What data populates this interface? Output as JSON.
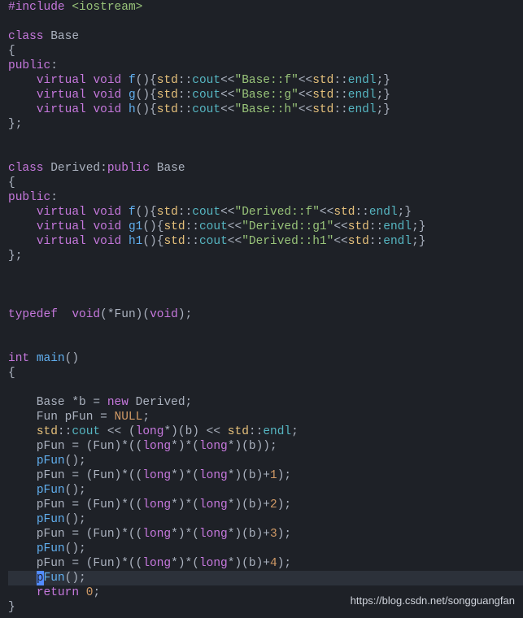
{
  "code": {
    "lines": [
      {
        "segments": [
          {
            "t": "#include",
            "c": "preprocessor"
          },
          {
            "t": " ",
            "c": "text-white"
          },
          {
            "t": "<iostream>",
            "c": "header-green"
          }
        ]
      },
      {
        "segments": []
      },
      {
        "segments": [
          {
            "t": "class",
            "c": "keyword-purple"
          },
          {
            "t": " Base",
            "c": "text-white"
          }
        ]
      },
      {
        "segments": [
          {
            "t": "{",
            "c": "text-white"
          }
        ]
      },
      {
        "segments": [
          {
            "t": "public",
            "c": "keyword-purple"
          },
          {
            "t": ":",
            "c": "text-white"
          }
        ]
      },
      {
        "segments": [
          {
            "t": "    ",
            "c": "text-white"
          },
          {
            "t": "virtual",
            "c": "keyword-purple"
          },
          {
            "t": " ",
            "c": "text-white"
          },
          {
            "t": "void",
            "c": "keyword-purple"
          },
          {
            "t": " ",
            "c": "text-white"
          },
          {
            "t": "f",
            "c": "func-blue"
          },
          {
            "t": "(){",
            "c": "text-white"
          },
          {
            "t": "std",
            "c": "std-yellow"
          },
          {
            "t": "::",
            "c": "text-white"
          },
          {
            "t": "cout",
            "c": "cout-teal"
          },
          {
            "t": "<<",
            "c": "text-white"
          },
          {
            "t": "\"Base::f\"",
            "c": "string-green"
          },
          {
            "t": "<<",
            "c": "text-white"
          },
          {
            "t": "std",
            "c": "std-yellow"
          },
          {
            "t": "::",
            "c": "text-white"
          },
          {
            "t": "endl",
            "c": "cout-teal"
          },
          {
            "t": ";}",
            "c": "text-white"
          }
        ]
      },
      {
        "segments": [
          {
            "t": "    ",
            "c": "text-white"
          },
          {
            "t": "virtual",
            "c": "keyword-purple"
          },
          {
            "t": " ",
            "c": "text-white"
          },
          {
            "t": "void",
            "c": "keyword-purple"
          },
          {
            "t": " ",
            "c": "text-white"
          },
          {
            "t": "g",
            "c": "func-blue"
          },
          {
            "t": "(){",
            "c": "text-white"
          },
          {
            "t": "std",
            "c": "std-yellow"
          },
          {
            "t": "::",
            "c": "text-white"
          },
          {
            "t": "cout",
            "c": "cout-teal"
          },
          {
            "t": "<<",
            "c": "text-white"
          },
          {
            "t": "\"Base::g\"",
            "c": "string-green"
          },
          {
            "t": "<<",
            "c": "text-white"
          },
          {
            "t": "std",
            "c": "std-yellow"
          },
          {
            "t": "::",
            "c": "text-white"
          },
          {
            "t": "endl",
            "c": "cout-teal"
          },
          {
            "t": ";}",
            "c": "text-white"
          }
        ]
      },
      {
        "segments": [
          {
            "t": "    ",
            "c": "text-white"
          },
          {
            "t": "virtual",
            "c": "keyword-purple"
          },
          {
            "t": " ",
            "c": "text-white"
          },
          {
            "t": "void",
            "c": "keyword-purple"
          },
          {
            "t": " ",
            "c": "text-white"
          },
          {
            "t": "h",
            "c": "func-blue"
          },
          {
            "t": "(){",
            "c": "text-white"
          },
          {
            "t": "std",
            "c": "std-yellow"
          },
          {
            "t": "::",
            "c": "text-white"
          },
          {
            "t": "cout",
            "c": "cout-teal"
          },
          {
            "t": "<<",
            "c": "text-white"
          },
          {
            "t": "\"Base::h\"",
            "c": "string-green"
          },
          {
            "t": "<<",
            "c": "text-white"
          },
          {
            "t": "std",
            "c": "std-yellow"
          },
          {
            "t": "::",
            "c": "text-white"
          },
          {
            "t": "endl",
            "c": "cout-teal"
          },
          {
            "t": ";}",
            "c": "text-white"
          }
        ]
      },
      {
        "segments": [
          {
            "t": "};",
            "c": "text-white"
          }
        ]
      },
      {
        "segments": []
      },
      {
        "segments": []
      },
      {
        "segments": [
          {
            "t": "class",
            "c": "keyword-purple"
          },
          {
            "t": " Derived:",
            "c": "text-white"
          },
          {
            "t": "public",
            "c": "keyword-purple"
          },
          {
            "t": " Base",
            "c": "text-white"
          }
        ]
      },
      {
        "segments": [
          {
            "t": "{",
            "c": "text-white"
          }
        ]
      },
      {
        "segments": [
          {
            "t": "public",
            "c": "keyword-purple"
          },
          {
            "t": ":",
            "c": "text-white"
          }
        ]
      },
      {
        "segments": [
          {
            "t": "    ",
            "c": "text-white"
          },
          {
            "t": "virtual",
            "c": "keyword-purple"
          },
          {
            "t": " ",
            "c": "text-white"
          },
          {
            "t": "void",
            "c": "keyword-purple"
          },
          {
            "t": " ",
            "c": "text-white"
          },
          {
            "t": "f",
            "c": "func-blue"
          },
          {
            "t": "(){",
            "c": "text-white"
          },
          {
            "t": "std",
            "c": "std-yellow"
          },
          {
            "t": "::",
            "c": "text-white"
          },
          {
            "t": "cout",
            "c": "cout-teal"
          },
          {
            "t": "<<",
            "c": "text-white"
          },
          {
            "t": "\"Derived::f\"",
            "c": "string-green"
          },
          {
            "t": "<<",
            "c": "text-white"
          },
          {
            "t": "std",
            "c": "std-yellow"
          },
          {
            "t": "::",
            "c": "text-white"
          },
          {
            "t": "endl",
            "c": "cout-teal"
          },
          {
            "t": ";}",
            "c": "text-white"
          }
        ]
      },
      {
        "segments": [
          {
            "t": "    ",
            "c": "text-white"
          },
          {
            "t": "virtual",
            "c": "keyword-purple"
          },
          {
            "t": " ",
            "c": "text-white"
          },
          {
            "t": "void",
            "c": "keyword-purple"
          },
          {
            "t": " ",
            "c": "text-white"
          },
          {
            "t": "g1",
            "c": "func-blue"
          },
          {
            "t": "(){",
            "c": "text-white"
          },
          {
            "t": "std",
            "c": "std-yellow"
          },
          {
            "t": "::",
            "c": "text-white"
          },
          {
            "t": "cout",
            "c": "cout-teal"
          },
          {
            "t": "<<",
            "c": "text-white"
          },
          {
            "t": "\"Derived::g1\"",
            "c": "string-green"
          },
          {
            "t": "<<",
            "c": "text-white"
          },
          {
            "t": "std",
            "c": "std-yellow"
          },
          {
            "t": "::",
            "c": "text-white"
          },
          {
            "t": "endl",
            "c": "cout-teal"
          },
          {
            "t": ";}",
            "c": "text-white"
          }
        ]
      },
      {
        "segments": [
          {
            "t": "    ",
            "c": "text-white"
          },
          {
            "t": "virtual",
            "c": "keyword-purple"
          },
          {
            "t": " ",
            "c": "text-white"
          },
          {
            "t": "void",
            "c": "keyword-purple"
          },
          {
            "t": " ",
            "c": "text-white"
          },
          {
            "t": "h1",
            "c": "func-blue"
          },
          {
            "t": "(){",
            "c": "text-white"
          },
          {
            "t": "std",
            "c": "std-yellow"
          },
          {
            "t": "::",
            "c": "text-white"
          },
          {
            "t": "cout",
            "c": "cout-teal"
          },
          {
            "t": "<<",
            "c": "text-white"
          },
          {
            "t": "\"Derived::h1\"",
            "c": "string-green"
          },
          {
            "t": "<<",
            "c": "text-white"
          },
          {
            "t": "std",
            "c": "std-yellow"
          },
          {
            "t": "::",
            "c": "text-white"
          },
          {
            "t": "endl",
            "c": "cout-teal"
          },
          {
            "t": ";}",
            "c": "text-white"
          }
        ]
      },
      {
        "segments": [
          {
            "t": "};",
            "c": "text-white"
          }
        ]
      },
      {
        "segments": []
      },
      {
        "segments": []
      },
      {
        "segments": []
      },
      {
        "segments": [
          {
            "t": "typedef",
            "c": "keyword-purple"
          },
          {
            "t": "  ",
            "c": "text-white"
          },
          {
            "t": "void",
            "c": "keyword-purple"
          },
          {
            "t": "(*Fun)(",
            "c": "text-white"
          },
          {
            "t": "void",
            "c": "keyword-purple"
          },
          {
            "t": ");",
            "c": "text-white"
          }
        ]
      },
      {
        "segments": []
      },
      {
        "segments": []
      },
      {
        "segments": [
          {
            "t": "int",
            "c": "keyword-purple"
          },
          {
            "t": " ",
            "c": "text-white"
          },
          {
            "t": "main",
            "c": "func-blue"
          },
          {
            "t": "()",
            "c": "text-white"
          }
        ]
      },
      {
        "segments": [
          {
            "t": "{",
            "c": "text-white"
          }
        ]
      },
      {
        "segments": []
      },
      {
        "segments": [
          {
            "t": "    Base *b = ",
            "c": "text-white"
          },
          {
            "t": "new",
            "c": "keyword-purple"
          },
          {
            "t": " Derived;",
            "c": "text-white"
          }
        ]
      },
      {
        "segments": [
          {
            "t": "    Fun pFun = ",
            "c": "text-white"
          },
          {
            "t": "NULL",
            "c": "null-orange"
          },
          {
            "t": ";",
            "c": "text-white"
          }
        ]
      },
      {
        "segments": [
          {
            "t": "    ",
            "c": "text-white"
          },
          {
            "t": "std",
            "c": "std-yellow"
          },
          {
            "t": "::",
            "c": "text-white"
          },
          {
            "t": "cout",
            "c": "cout-teal"
          },
          {
            "t": " << (",
            "c": "text-white"
          },
          {
            "t": "long",
            "c": "keyword-purple"
          },
          {
            "t": "*)(b) << ",
            "c": "text-white"
          },
          {
            "t": "std",
            "c": "std-yellow"
          },
          {
            "t": "::",
            "c": "text-white"
          },
          {
            "t": "endl",
            "c": "cout-teal"
          },
          {
            "t": ";",
            "c": "text-white"
          }
        ]
      },
      {
        "segments": [
          {
            "t": "    pFun = (Fun)*((",
            "c": "text-white"
          },
          {
            "t": "long",
            "c": "keyword-purple"
          },
          {
            "t": "*)*(",
            "c": "text-white"
          },
          {
            "t": "long",
            "c": "keyword-purple"
          },
          {
            "t": "*)(b));",
            "c": "text-white"
          }
        ]
      },
      {
        "segments": [
          {
            "t": "    ",
            "c": "text-white"
          },
          {
            "t": "pFun",
            "c": "func-blue"
          },
          {
            "t": "();",
            "c": "text-white"
          }
        ]
      },
      {
        "segments": [
          {
            "t": "    pFun = (Fun)*((",
            "c": "text-white"
          },
          {
            "t": "long",
            "c": "keyword-purple"
          },
          {
            "t": "*)*(",
            "c": "text-white"
          },
          {
            "t": "long",
            "c": "keyword-purple"
          },
          {
            "t": "*)(b)+",
            "c": "text-white"
          },
          {
            "t": "1",
            "c": "number-orange"
          },
          {
            "t": ");",
            "c": "text-white"
          }
        ]
      },
      {
        "segments": [
          {
            "t": "    ",
            "c": "text-white"
          },
          {
            "t": "pFun",
            "c": "func-blue"
          },
          {
            "t": "();",
            "c": "text-white"
          }
        ]
      },
      {
        "segments": [
          {
            "t": "    pFun = (Fun)*((",
            "c": "text-white"
          },
          {
            "t": "long",
            "c": "keyword-purple"
          },
          {
            "t": "*)*(",
            "c": "text-white"
          },
          {
            "t": "long",
            "c": "keyword-purple"
          },
          {
            "t": "*)(b)+",
            "c": "text-white"
          },
          {
            "t": "2",
            "c": "number-orange"
          },
          {
            "t": ");",
            "c": "text-white"
          }
        ]
      },
      {
        "segments": [
          {
            "t": "    ",
            "c": "text-white"
          },
          {
            "t": "pFun",
            "c": "func-blue"
          },
          {
            "t": "();",
            "c": "text-white"
          }
        ]
      },
      {
        "segments": [
          {
            "t": "    pFun = (Fun)*((",
            "c": "text-white"
          },
          {
            "t": "long",
            "c": "keyword-purple"
          },
          {
            "t": "*)*(",
            "c": "text-white"
          },
          {
            "t": "long",
            "c": "keyword-purple"
          },
          {
            "t": "*)(b)+",
            "c": "text-white"
          },
          {
            "t": "3",
            "c": "number-orange"
          },
          {
            "t": ");",
            "c": "text-white"
          }
        ]
      },
      {
        "segments": [
          {
            "t": "    ",
            "c": "text-white"
          },
          {
            "t": "pFun",
            "c": "func-blue"
          },
          {
            "t": "();",
            "c": "text-white"
          }
        ]
      },
      {
        "segments": [
          {
            "t": "    pFun = (Fun)*((",
            "c": "text-white"
          },
          {
            "t": "long",
            "c": "keyword-purple"
          },
          {
            "t": "*)*(",
            "c": "text-white"
          },
          {
            "t": "long",
            "c": "keyword-purple"
          },
          {
            "t": "*)(b)+",
            "c": "text-white"
          },
          {
            "t": "4",
            "c": "number-orange"
          },
          {
            "t": ");",
            "c": "text-white"
          }
        ]
      },
      {
        "highlighted": true,
        "cursor": true,
        "segments": [
          {
            "t": "    ",
            "c": "text-white"
          },
          {
            "t": "p",
            "c": "func-blue",
            "cursor": true
          },
          {
            "t": "Fun",
            "c": "func-blue"
          },
          {
            "t": "();",
            "c": "text-white"
          }
        ]
      },
      {
        "segments": [
          {
            "t": "    ",
            "c": "text-white"
          },
          {
            "t": "return",
            "c": "keyword-purple"
          },
          {
            "t": " ",
            "c": "text-white"
          },
          {
            "t": "0",
            "c": "number-orange"
          },
          {
            "t": ";",
            "c": "text-white"
          }
        ]
      },
      {
        "segments": [
          {
            "t": "}",
            "c": "text-white"
          }
        ]
      }
    ]
  },
  "watermark": "https://blog.csdn.net/songguangfan"
}
